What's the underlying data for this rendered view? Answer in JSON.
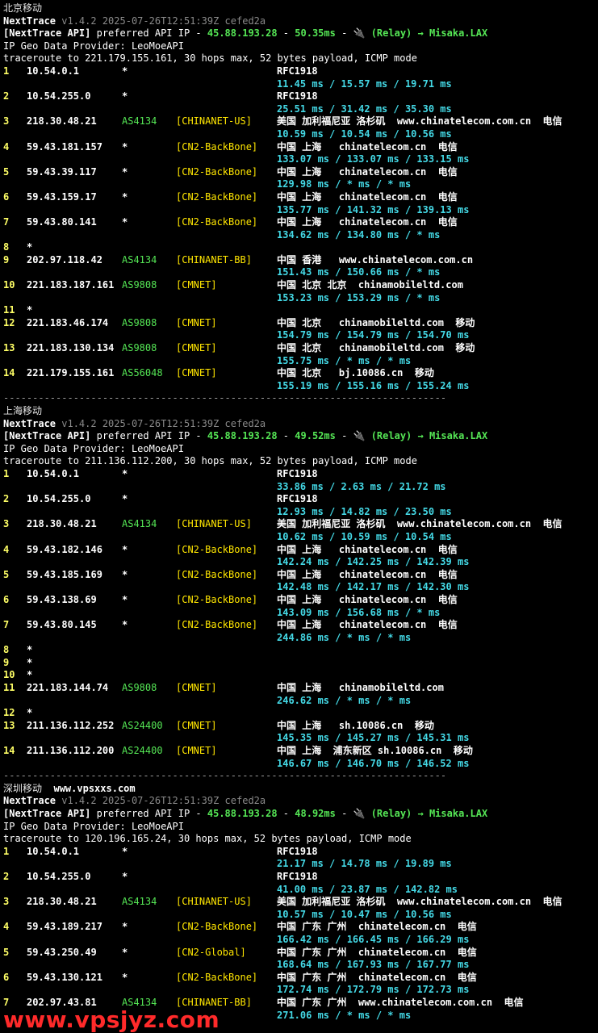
{
  "sections": [
    {
      "site": "北京移动",
      "site_extra": "",
      "nt_name": "NextTrace",
      "nt_version": "v1.4.2 2025-07-26T12:51:39Z cefed2a",
      "api_prefix": "[NextTrace API]",
      "api_mid": " preferred API IP - ",
      "api_ip": "45.88.193.28",
      "api_dash": " - ",
      "api_latency": "50.35ms",
      "api_dash2": " - ",
      "api_relay": "🔌 (Relay) → Misaka.LAX",
      "geo_provider": "IP Geo Data Provider: LeoMoeAPI",
      "trace_line": "traceroute to 221.179.155.161, 30 hops max, 52 bytes payload, ICMP mode",
      "hops": [
        {
          "hop": "1",
          "ip": "10.54.0.1",
          "as": "*",
          "tag": "",
          "geo": "RFC1918",
          "rtt": "11.45 ms / 15.57 ms / 19.71 ms"
        },
        {
          "hop": "2",
          "ip": "10.54.255.0",
          "as": "*",
          "tag": "",
          "geo": "RFC1918",
          "rtt": "25.51 ms / 31.42 ms / 35.30 ms"
        },
        {
          "hop": "3",
          "ip": "218.30.48.21",
          "as": "AS4134",
          "tag": "[CHINANET-US]",
          "geo": "美国 加利福尼亚 洛杉矶  www.chinatelecom.com.cn  电信",
          "rtt": "10.59 ms / 10.54 ms / 10.56 ms"
        },
        {
          "hop": "4",
          "ip": "59.43.181.157",
          "as": "*",
          "tag": "[CN2-BackBone]",
          "geo": "中国 上海   chinatelecom.cn  电信",
          "rtt": "133.07 ms / 133.07 ms / 133.15 ms"
        },
        {
          "hop": "5",
          "ip": "59.43.39.117",
          "as": "*",
          "tag": "[CN2-BackBone]",
          "geo": "中国 上海   chinatelecom.cn  电信",
          "rtt": "129.98 ms / * ms / * ms"
        },
        {
          "hop": "6",
          "ip": "59.43.159.17",
          "as": "*",
          "tag": "[CN2-BackBone]",
          "geo": "中国 上海   chinatelecom.cn  电信",
          "rtt": "135.77 ms / 141.32 ms / 139.13 ms"
        },
        {
          "hop": "7",
          "ip": "59.43.80.141",
          "as": "*",
          "tag": "[CN2-BackBone]",
          "geo": "中国 上海   chinatelecom.cn  电信",
          "rtt": "134.62 ms / 134.80 ms / * ms"
        },
        {
          "hop": "8",
          "ip": "*",
          "as": "",
          "tag": "",
          "geo": "",
          "rtt": ""
        },
        {
          "hop": "9",
          "ip": "202.97.118.42",
          "as": "AS4134",
          "tag": "[CHINANET-BB]",
          "geo": "中国 香港   www.chinatelecom.com.cn",
          "rtt": "151.43 ms / 150.66 ms / * ms"
        },
        {
          "hop": "10",
          "ip": "221.183.187.161",
          "as": "AS9808",
          "tag": "[CMNET]",
          "geo": "中国 北京 北京  chinamobileltd.com",
          "rtt": "153.23 ms / 153.29 ms / * ms"
        },
        {
          "hop": "11",
          "ip": "*",
          "as": "",
          "tag": "",
          "geo": "",
          "rtt": ""
        },
        {
          "hop": "12",
          "ip": "221.183.46.174",
          "as": "AS9808",
          "tag": "[CMNET]",
          "geo": "中国 北京   chinamobileltd.com  移动",
          "rtt": "154.79 ms / 154.79 ms / 154.70 ms"
        },
        {
          "hop": "13",
          "ip": "221.183.130.134",
          "as": "AS9808",
          "tag": "[CMNET]",
          "geo": "中国 北京   chinamobileltd.com  移动",
          "rtt": "155.75 ms / * ms / * ms"
        },
        {
          "hop": "14",
          "ip": "221.179.155.161",
          "as": "AS56048",
          "tag": "[CMNET]",
          "geo": "中国 北京   bj.10086.cn  移动",
          "rtt": "155.19 ms / 155.16 ms / 155.24 ms"
        }
      ],
      "separator": "----------------------------------------------------------------------------"
    },
    {
      "site": "上海移动",
      "site_extra": "",
      "nt_name": "NextTrace",
      "nt_version": "v1.4.2 2025-07-26T12:51:39Z cefed2a",
      "api_prefix": "[NextTrace API]",
      "api_mid": " preferred API IP - ",
      "api_ip": "45.88.193.28",
      "api_dash": " - ",
      "api_latency": "49.52ms",
      "api_dash2": " - ",
      "api_relay": "🔌 (Relay) → Misaka.LAX",
      "geo_provider": "IP Geo Data Provider: LeoMoeAPI",
      "trace_line": "traceroute to 211.136.112.200, 30 hops max, 52 bytes payload, ICMP mode",
      "hops": [
        {
          "hop": "1",
          "ip": "10.54.0.1",
          "as": "*",
          "tag": "",
          "geo": "RFC1918",
          "rtt": "33.86 ms / 2.63 ms / 21.72 ms"
        },
        {
          "hop": "2",
          "ip": "10.54.255.0",
          "as": "*",
          "tag": "",
          "geo": "RFC1918",
          "rtt": "12.93 ms / 14.82 ms / 23.50 ms"
        },
        {
          "hop": "3",
          "ip": "218.30.48.21",
          "as": "AS4134",
          "tag": "[CHINANET-US]",
          "geo": "美国 加利福尼亚 洛杉矶  www.chinatelecom.com.cn  电信",
          "rtt": "10.62 ms / 10.59 ms / 10.54 ms"
        },
        {
          "hop": "4",
          "ip": "59.43.182.146",
          "as": "*",
          "tag": "[CN2-BackBone]",
          "geo": "中国 上海   chinatelecom.cn  电信",
          "rtt": "142.24 ms / 142.25 ms / 142.39 ms"
        },
        {
          "hop": "5",
          "ip": "59.43.185.169",
          "as": "*",
          "tag": "[CN2-BackBone]",
          "geo": "中国 上海   chinatelecom.cn  电信",
          "rtt": "142.48 ms / 142.17 ms / 142.30 ms"
        },
        {
          "hop": "6",
          "ip": "59.43.138.69",
          "as": "*",
          "tag": "[CN2-BackBone]",
          "geo": "中国 上海   chinatelecom.cn  电信",
          "rtt": "143.09 ms / 156.68 ms / * ms"
        },
        {
          "hop": "7",
          "ip": "59.43.80.145",
          "as": "*",
          "tag": "[CN2-BackBone]",
          "geo": "中国 上海   chinatelecom.cn  电信",
          "rtt": "244.86 ms / * ms / * ms"
        },
        {
          "hop": "8",
          "ip": "*",
          "as": "",
          "tag": "",
          "geo": "",
          "rtt": ""
        },
        {
          "hop": "9",
          "ip": "*",
          "as": "",
          "tag": "",
          "geo": "",
          "rtt": ""
        },
        {
          "hop": "10",
          "ip": "*",
          "as": "",
          "tag": "",
          "geo": "",
          "rtt": ""
        },
        {
          "hop": "11",
          "ip": "221.183.144.74",
          "as": "AS9808",
          "tag": "[CMNET]",
          "geo": "中国 上海   chinamobileltd.com",
          "rtt": "246.62 ms / * ms / * ms"
        },
        {
          "hop": "12",
          "ip": "*",
          "as": "",
          "tag": "",
          "geo": "",
          "rtt": ""
        },
        {
          "hop": "13",
          "ip": "211.136.112.252",
          "as": "AS24400",
          "tag": "[CMNET]",
          "geo": "中国 上海   sh.10086.cn  移动",
          "rtt": "145.35 ms / 145.27 ms / 145.31 ms"
        },
        {
          "hop": "14",
          "ip": "211.136.112.200",
          "as": "AS24400",
          "tag": "[CMNET]",
          "geo": "中国 上海  浦东新区 sh.10086.cn  移动",
          "rtt": "146.67 ms / 146.70 ms / 146.52 ms"
        }
      ],
      "separator": "----------------------------------------------------------------------------"
    },
    {
      "site": "深圳移动",
      "site_extra": "www.vpsxxs.com",
      "nt_name": "NextTrace",
      "nt_version": "v1.4.2 2025-07-26T12:51:39Z cefed2a",
      "api_prefix": "[NextTrace API]",
      "api_mid": " preferred API IP - ",
      "api_ip": "45.88.193.28",
      "api_dash": " - ",
      "api_latency": "48.92ms",
      "api_dash2": " - ",
      "api_relay": "🔌 (Relay) → Misaka.LAX",
      "geo_provider": "IP Geo Data Provider: LeoMoeAPI",
      "trace_line": "traceroute to 120.196.165.24, 30 hops max, 52 bytes payload, ICMP mode",
      "hops": [
        {
          "hop": "1",
          "ip": "10.54.0.1",
          "as": "*",
          "tag": "",
          "geo": "RFC1918",
          "rtt": "21.17 ms / 14.78 ms / 19.89 ms"
        },
        {
          "hop": "2",
          "ip": "10.54.255.0",
          "as": "*",
          "tag": "",
          "geo": "RFC1918",
          "rtt": "41.00 ms / 23.87 ms / 142.82 ms"
        },
        {
          "hop": "3",
          "ip": "218.30.48.21",
          "as": "AS4134",
          "tag": "[CHINANET-US]",
          "geo": "美国 加利福尼亚 洛杉矶  www.chinatelecom.com.cn  电信",
          "rtt": "10.57 ms / 10.47 ms / 10.56 ms"
        },
        {
          "hop": "4",
          "ip": "59.43.189.217",
          "as": "*",
          "tag": "[CN2-BackBone]",
          "geo": "中国 广东 广州  chinatelecom.cn  电信",
          "rtt": "166.42 ms / 166.45 ms / 166.29 ms"
        },
        {
          "hop": "5",
          "ip": "59.43.250.49",
          "as": "*",
          "tag": "[CN2-Global]",
          "geo": "中国 广东 广州  chinatelecom.cn  电信",
          "rtt": "168.64 ms / 167.93 ms / 167.77 ms"
        },
        {
          "hop": "6",
          "ip": "59.43.130.121",
          "as": "*",
          "tag": "[CN2-BackBone]",
          "geo": "中国 广东 广州  chinatelecom.cn  电信",
          "rtt": "172.74 ms / 172.79 ms / 172.73 ms"
        },
        {
          "hop": "7",
          "ip": "202.97.43.81",
          "as": "AS4134",
          "tag": "[CHINANET-BB]",
          "geo": "中国 广东 广州  www.chinatelecom.com.cn  电信",
          "rtt": "271.06 ms / * ms / * ms"
        }
      ],
      "separator": ""
    }
  ],
  "watermark": "www.vpsjyz.com"
}
